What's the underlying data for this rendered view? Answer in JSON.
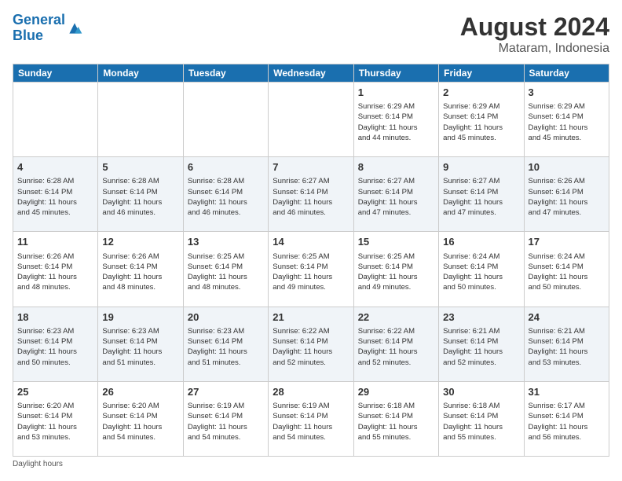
{
  "header": {
    "logo_line1": "General",
    "logo_line2": "Blue",
    "main_title": "August 2024",
    "subtitle": "Mataram, Indonesia"
  },
  "days_of_week": [
    "Sunday",
    "Monday",
    "Tuesday",
    "Wednesday",
    "Thursday",
    "Friday",
    "Saturday"
  ],
  "weeks": [
    [
      {
        "day": "",
        "info": ""
      },
      {
        "day": "",
        "info": ""
      },
      {
        "day": "",
        "info": ""
      },
      {
        "day": "",
        "info": ""
      },
      {
        "day": "1",
        "info": "Sunrise: 6:29 AM\nSunset: 6:14 PM\nDaylight: 11 hours\nand 44 minutes."
      },
      {
        "day": "2",
        "info": "Sunrise: 6:29 AM\nSunset: 6:14 PM\nDaylight: 11 hours\nand 45 minutes."
      },
      {
        "day": "3",
        "info": "Sunrise: 6:29 AM\nSunset: 6:14 PM\nDaylight: 11 hours\nand 45 minutes."
      }
    ],
    [
      {
        "day": "4",
        "info": "Sunrise: 6:28 AM\nSunset: 6:14 PM\nDaylight: 11 hours\nand 45 minutes."
      },
      {
        "day": "5",
        "info": "Sunrise: 6:28 AM\nSunset: 6:14 PM\nDaylight: 11 hours\nand 46 minutes."
      },
      {
        "day": "6",
        "info": "Sunrise: 6:28 AM\nSunset: 6:14 PM\nDaylight: 11 hours\nand 46 minutes."
      },
      {
        "day": "7",
        "info": "Sunrise: 6:27 AM\nSunset: 6:14 PM\nDaylight: 11 hours\nand 46 minutes."
      },
      {
        "day": "8",
        "info": "Sunrise: 6:27 AM\nSunset: 6:14 PM\nDaylight: 11 hours\nand 47 minutes."
      },
      {
        "day": "9",
        "info": "Sunrise: 6:27 AM\nSunset: 6:14 PM\nDaylight: 11 hours\nand 47 minutes."
      },
      {
        "day": "10",
        "info": "Sunrise: 6:26 AM\nSunset: 6:14 PM\nDaylight: 11 hours\nand 47 minutes."
      }
    ],
    [
      {
        "day": "11",
        "info": "Sunrise: 6:26 AM\nSunset: 6:14 PM\nDaylight: 11 hours\nand 48 minutes."
      },
      {
        "day": "12",
        "info": "Sunrise: 6:26 AM\nSunset: 6:14 PM\nDaylight: 11 hours\nand 48 minutes."
      },
      {
        "day": "13",
        "info": "Sunrise: 6:25 AM\nSunset: 6:14 PM\nDaylight: 11 hours\nand 48 minutes."
      },
      {
        "day": "14",
        "info": "Sunrise: 6:25 AM\nSunset: 6:14 PM\nDaylight: 11 hours\nand 49 minutes."
      },
      {
        "day": "15",
        "info": "Sunrise: 6:25 AM\nSunset: 6:14 PM\nDaylight: 11 hours\nand 49 minutes."
      },
      {
        "day": "16",
        "info": "Sunrise: 6:24 AM\nSunset: 6:14 PM\nDaylight: 11 hours\nand 50 minutes."
      },
      {
        "day": "17",
        "info": "Sunrise: 6:24 AM\nSunset: 6:14 PM\nDaylight: 11 hours\nand 50 minutes."
      }
    ],
    [
      {
        "day": "18",
        "info": "Sunrise: 6:23 AM\nSunset: 6:14 PM\nDaylight: 11 hours\nand 50 minutes."
      },
      {
        "day": "19",
        "info": "Sunrise: 6:23 AM\nSunset: 6:14 PM\nDaylight: 11 hours\nand 51 minutes."
      },
      {
        "day": "20",
        "info": "Sunrise: 6:23 AM\nSunset: 6:14 PM\nDaylight: 11 hours\nand 51 minutes."
      },
      {
        "day": "21",
        "info": "Sunrise: 6:22 AM\nSunset: 6:14 PM\nDaylight: 11 hours\nand 52 minutes."
      },
      {
        "day": "22",
        "info": "Sunrise: 6:22 AM\nSunset: 6:14 PM\nDaylight: 11 hours\nand 52 minutes."
      },
      {
        "day": "23",
        "info": "Sunrise: 6:21 AM\nSunset: 6:14 PM\nDaylight: 11 hours\nand 52 minutes."
      },
      {
        "day": "24",
        "info": "Sunrise: 6:21 AM\nSunset: 6:14 PM\nDaylight: 11 hours\nand 53 minutes."
      }
    ],
    [
      {
        "day": "25",
        "info": "Sunrise: 6:20 AM\nSunset: 6:14 PM\nDaylight: 11 hours\nand 53 minutes."
      },
      {
        "day": "26",
        "info": "Sunrise: 6:20 AM\nSunset: 6:14 PM\nDaylight: 11 hours\nand 54 minutes."
      },
      {
        "day": "27",
        "info": "Sunrise: 6:19 AM\nSunset: 6:14 PM\nDaylight: 11 hours\nand 54 minutes."
      },
      {
        "day": "28",
        "info": "Sunrise: 6:19 AM\nSunset: 6:14 PM\nDaylight: 11 hours\nand 54 minutes."
      },
      {
        "day": "29",
        "info": "Sunrise: 6:18 AM\nSunset: 6:14 PM\nDaylight: 11 hours\nand 55 minutes."
      },
      {
        "day": "30",
        "info": "Sunrise: 6:18 AM\nSunset: 6:14 PM\nDaylight: 11 hours\nand 55 minutes."
      },
      {
        "day": "31",
        "info": "Sunrise: 6:17 AM\nSunset: 6:14 PM\nDaylight: 11 hours\nand 56 minutes."
      }
    ]
  ],
  "footer": {
    "daylight_label": "Daylight hours"
  }
}
